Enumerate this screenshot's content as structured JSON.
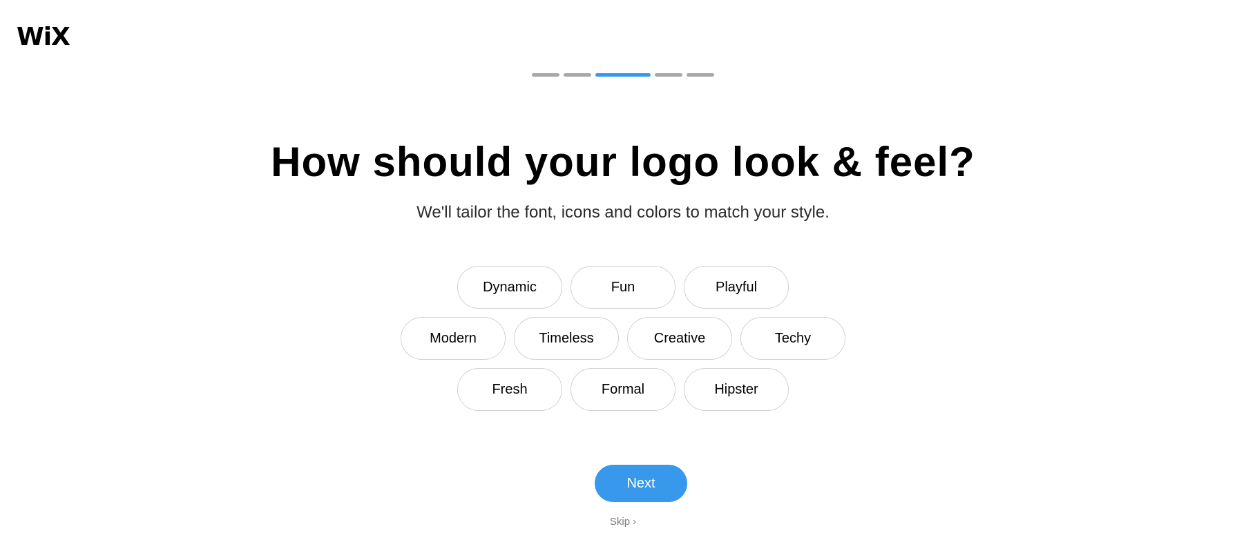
{
  "brand": {
    "logo_text": "WiX"
  },
  "progress": {
    "total_steps": 5,
    "current_step": 3
  },
  "heading": {
    "title": "How should your logo look & feel?",
    "subtitle": "We'll tailor the font, icons and colors to match your style."
  },
  "options": {
    "rows": [
      [
        "Dynamic",
        "Fun",
        "Playful"
      ],
      [
        "Modern",
        "Timeless",
        "Creative",
        "Techy"
      ],
      [
        "Fresh",
        "Formal",
        "Hipster"
      ]
    ],
    "selected": []
  },
  "actions": {
    "next_label": "Next",
    "skip_label": "Skip",
    "skip_icon": "chevron-right-icon"
  },
  "colors": {
    "accent": "#3899ec",
    "inactive_step": "#a8a8a8",
    "chip_border": "#d0d0d0"
  }
}
